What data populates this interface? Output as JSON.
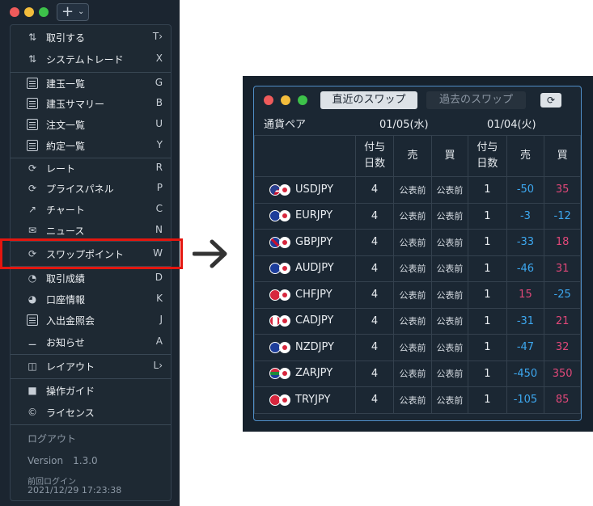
{
  "app": {
    "menu_items": [
      {
        "label": "取引する",
        "key": "T",
        "icon": "trade-icon"
      },
      {
        "label": "システムトレード",
        "key": "X",
        "icon": "system-trade-icon"
      },
      {
        "label": "建玉一覧",
        "key": "G",
        "icon": "list-icon"
      },
      {
        "label": "建玉サマリー",
        "key": "B",
        "icon": "list-icon"
      },
      {
        "label": "注文一覧",
        "key": "U",
        "icon": "list-icon"
      },
      {
        "label": "約定一覧",
        "key": "Y",
        "icon": "list-icon"
      },
      {
        "label": "レート",
        "key": "R",
        "icon": "rate-icon"
      },
      {
        "label": "プライスパネル",
        "key": "P",
        "icon": "price-panel-icon"
      },
      {
        "label": "チャート",
        "key": "C",
        "icon": "chart-icon"
      },
      {
        "label": "ニュース",
        "key": "N",
        "icon": "news-icon"
      },
      {
        "label": "スワップポイント",
        "key": "W",
        "icon": "swap-icon"
      },
      {
        "label": "取引成績",
        "key": "D",
        "icon": "performance-icon"
      },
      {
        "label": "口座情報",
        "key": "K",
        "icon": "account-icon"
      },
      {
        "label": "入出金照会",
        "key": "J",
        "icon": "deposit-icon"
      },
      {
        "label": "お知らせ",
        "key": "A",
        "icon": "bell-icon"
      },
      {
        "label": "レイアウト",
        "key": "L",
        "icon": "layout-icon"
      },
      {
        "label": "操作ガイド",
        "key": "",
        "icon": "guide-icon"
      },
      {
        "label": "ライセンス",
        "key": "",
        "icon": "copyright-icon"
      }
    ],
    "logout": "ログアウト",
    "version": "Version　1.3.0",
    "last_login_label": "前回ログイン",
    "last_login_time": "2021/12/29 17:23:38"
  },
  "swap": {
    "tabs": {
      "recent": "直近のスワップ",
      "past": "過去のスワップ"
    },
    "pair_header": "通貨ペア",
    "date1": "01/05(水)",
    "date2": "01/04(火)",
    "columns": {
      "days_line1": "付与",
      "days_line2": "日数",
      "sell": "売",
      "buy": "買"
    },
    "rows": [
      {
        "pair": "USDJPY",
        "d1": "4",
        "s1": "公表前",
        "b1": "公表前",
        "d2": "1",
        "s2": "-50",
        "b2": "35"
      },
      {
        "pair": "EURJPY",
        "d1": "4",
        "s1": "公表前",
        "b1": "公表前",
        "d2": "1",
        "s2": "-3",
        "b2": "-12"
      },
      {
        "pair": "GBPJPY",
        "d1": "4",
        "s1": "公表前",
        "b1": "公表前",
        "d2": "1",
        "s2": "-33",
        "b2": "18"
      },
      {
        "pair": "AUDJPY",
        "d1": "4",
        "s1": "公表前",
        "b1": "公表前",
        "d2": "1",
        "s2": "-46",
        "b2": "31"
      },
      {
        "pair": "CHFJPY",
        "d1": "4",
        "s1": "公表前",
        "b1": "公表前",
        "d2": "1",
        "s2": "15",
        "b2": "-25"
      },
      {
        "pair": "CADJPY",
        "d1": "4",
        "s1": "公表前",
        "b1": "公表前",
        "d2": "1",
        "s2": "-31",
        "b2": "21"
      },
      {
        "pair": "NZDJPY",
        "d1": "4",
        "s1": "公表前",
        "b1": "公表前",
        "d2": "1",
        "s2": "-47",
        "b2": "32"
      },
      {
        "pair": "ZARJPY",
        "d1": "4",
        "s1": "公表前",
        "b1": "公表前",
        "d2": "1",
        "s2": "-450",
        "b2": "350"
      },
      {
        "pair": "TRYJPY",
        "d1": "4",
        "s1": "公表前",
        "b1": "公表前",
        "d2": "1",
        "s2": "-105",
        "b2": "85"
      }
    ]
  },
  "colors": {
    "negative": "#3da8f0",
    "positive": "#e04879",
    "highlight": "#e4160f",
    "panel_border": "#4f8ec7"
  }
}
